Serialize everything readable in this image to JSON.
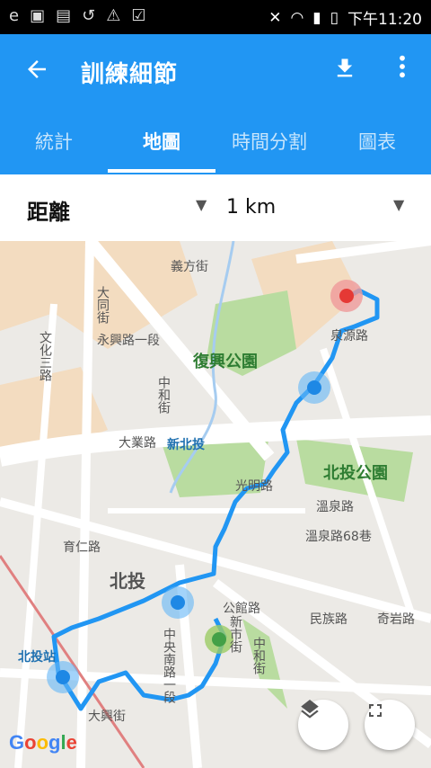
{
  "status": {
    "left_icons": [
      "e",
      "▣",
      "▤",
      "↺",
      "⚠",
      "☑"
    ],
    "time": "下午11:20"
  },
  "appbar": {
    "title": "訓練細節",
    "back_icon": "back-arrow-icon",
    "download_icon": "download-icon",
    "more_icon": "more-vert-icon"
  },
  "tabs": [
    "統計",
    "地圖",
    "時間分割",
    "圖表"
  ],
  "active_tab": 1,
  "filters": {
    "metric": "距離",
    "interval": "1 km"
  },
  "map": {
    "labels": {
      "yifang": "義方街",
      "datong": "大同街",
      "wenhua": "文化三路",
      "yongxing": "永興路一段",
      "fuxing_park": "復興公園",
      "zhongheng": "中和街",
      "daye": "大業路",
      "xinbeitou": "新北投",
      "quanyuan": "泉源路",
      "guangming": "光明路",
      "beitou_park": "北投公園",
      "wenquan": "溫泉路",
      "wenquan68": "溫泉路68巷",
      "youren": "育仁路",
      "beitou": "北投",
      "gongguan": "公館路",
      "xinshi": "新市街",
      "minzu": "民族路",
      "qiyan": "奇岩路",
      "beitou_station": "北投站",
      "zhongyang": "中央南路一段",
      "daxing": "大興街",
      "zhonghe": "中和街"
    },
    "google": "Google",
    "layers_icon": "layers-icon",
    "fullscreen_icon": "fullscreen-icon"
  }
}
